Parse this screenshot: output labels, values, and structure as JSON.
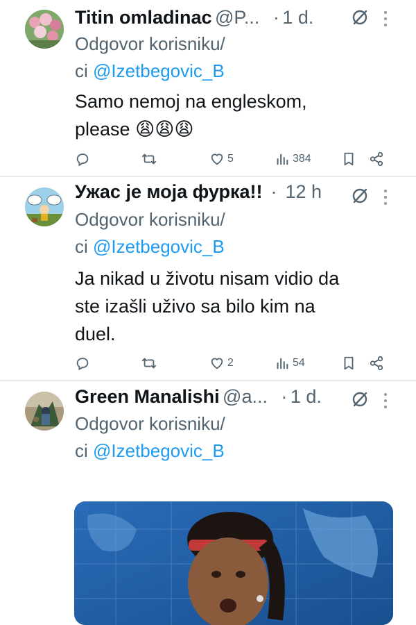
{
  "tweets": [
    {
      "name": "Titin omladinac",
      "handle": "@P...",
      "time": "1 d.",
      "reply_prefix_1": "Odgovor korisniku/",
      "reply_prefix_2": "ci ",
      "reply_mention": "@Izetbegovic_B",
      "text_line_1": "Samo nemoj na engleskom,",
      "text_line_2": "please",
      "emoji": "😩😩😩",
      "likes": "5",
      "views": "384"
    },
    {
      "name": "Ужас је моја фурка!!",
      "handle": "",
      "time": "12 h",
      "reply_prefix_1": "Odgovor korisniku/",
      "reply_prefix_2": "ci ",
      "reply_mention": "@Izetbegovic_B",
      "text_line_1": "Ja nikad u životu nisam vidio da",
      "text_line_2": "ste izašli uživo sa bilo kim na",
      "text_line_3": "duel.",
      "likes": "2",
      "views": "54"
    },
    {
      "name": "Green Manalishi",
      "handle": "@a...",
      "time": "1 d.",
      "reply_prefix_1": "Odgovor korisniku/",
      "reply_prefix_2": "ci ",
      "reply_mention": "@Izetbegovic_B"
    }
  ],
  "icons": {
    "reply": "reply-icon",
    "retweet": "retweet-icon",
    "like": "heart-icon",
    "views": "views-icon",
    "bookmark": "bookmark-icon",
    "share": "share-icon",
    "grok": "grok-icon",
    "more": "more-icon"
  },
  "colors": {
    "text": "#0f1419",
    "secondary": "#536471",
    "link": "#1d9bf0",
    "divider": "#e7e9ea"
  }
}
